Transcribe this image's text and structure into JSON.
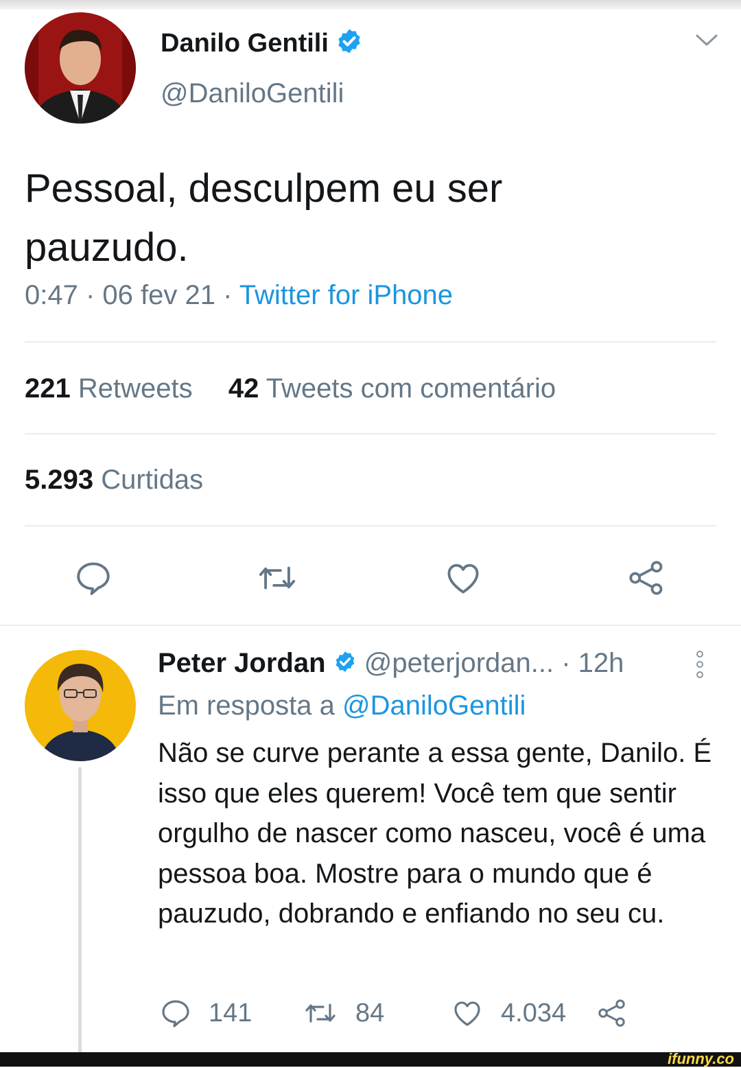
{
  "tweet": {
    "author_name": "Danilo Gentili",
    "author_handle": "@DaniloGentili",
    "text": "Pessoal, desculpem eu ser pauzudo.",
    "time_date": "0:47 · 06 fev 21 · ",
    "source": "Twitter for iPhone",
    "retweets_count": "221",
    "retweets_label": "Retweets",
    "quotes_count": "42",
    "quotes_label": "Tweets com comentário",
    "likes_count": "5.293",
    "likes_label": "Curtidas",
    "actions": [
      "reply-icon",
      "retweet-icon",
      "like-icon",
      "share-icon"
    ]
  },
  "reply": {
    "author_name": "Peter Jordan",
    "author_handle": "@peterjordan...",
    "time": "· 12h",
    "in_reply_prefix": "Em resposta a ",
    "in_reply_handle": "@DaniloGentili",
    "text": "Não se curve perante a essa gente, Danilo. É isso que eles querem! Você tem que sentir orgulho de nascer como nasceu, você é uma pessoa boa. Mostre para o mundo que é pauzudo, dobrando e enfiando no seu cu.",
    "reply_count": "141",
    "retweet_count": "84",
    "like_count": "4.034"
  },
  "watermark": "ifunny.co",
  "colors": {
    "verified": "#1da1f2",
    "link": "#1b95e0",
    "secondary_text": "#657786",
    "divider": "#e6ecf0"
  }
}
